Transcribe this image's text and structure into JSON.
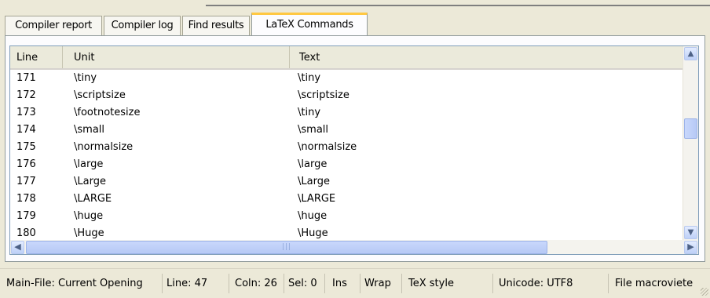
{
  "tabs": [
    {
      "label": "Compiler report",
      "active": false
    },
    {
      "label": "Compiler log",
      "active": false
    },
    {
      "label": "Find results",
      "active": false
    },
    {
      "label": "LaTeX Commands",
      "active": true
    }
  ],
  "columns": [
    "Line",
    "Unit",
    "Text"
  ],
  "rows": [
    {
      "line": "171",
      "unit": "\\tiny",
      "text": "\\tiny"
    },
    {
      "line": "172",
      "unit": "\\scriptsize",
      "text": "\\scriptsize"
    },
    {
      "line": "173",
      "unit": "\\footnotesize",
      "text": "\\tiny"
    },
    {
      "line": "174",
      "unit": "\\small",
      "text": "\\small"
    },
    {
      "line": "175",
      "unit": "\\normalsize",
      "text": "\\normalsize"
    },
    {
      "line": "176",
      "unit": "\\large",
      "text": "\\large"
    },
    {
      "line": "177",
      "unit": "\\Large",
      "text": "\\Large"
    },
    {
      "line": "178",
      "unit": "\\LARGE",
      "text": "\\LARGE"
    },
    {
      "line": "179",
      "unit": "\\huge",
      "text": "\\huge"
    },
    {
      "line": "180",
      "unit": "\\Huge",
      "text": "\\Huge"
    }
  ],
  "statusbar": {
    "main_file": "Main-File: Current Opening",
    "line": "Line: 47",
    "coln": "Coln: 26",
    "sel": "Sel: 0",
    "ins": "Ins",
    "wrap": "Wrap",
    "style": "TeX style",
    "encoding": "Unicode: UTF8",
    "file": "File macroviete"
  },
  "icons": {
    "scroll_up": "chevron-up-icon",
    "scroll_down": "chevron-down-icon",
    "scroll_left": "chevron-left-icon",
    "scroll_right": "chevron-right-icon",
    "grip": "resize-grip-icon"
  },
  "colors": {
    "active_tab_accent": "#ffc842",
    "window_bg": "#ece9d8",
    "scroll_thumb": "#c1d3fb"
  }
}
